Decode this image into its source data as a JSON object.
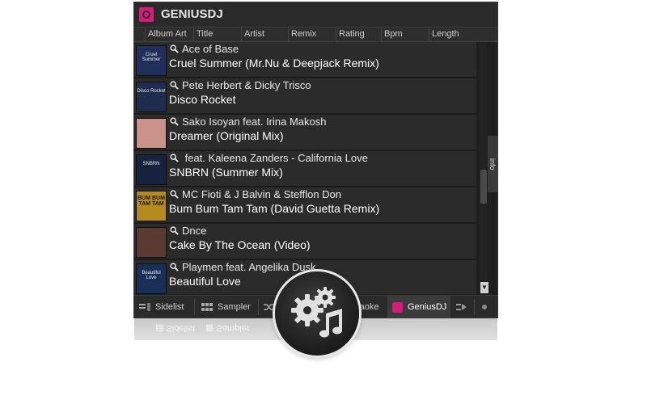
{
  "app": {
    "title": "GENIUSDJ"
  },
  "columns": [
    "Album Art",
    "Title",
    "Artist",
    "Remix",
    "Rating",
    "Bpm",
    "Length"
  ],
  "tracks": [
    {
      "artist": "Ace of Base",
      "title": "Cruel Summer (Mr.Nu & Deepjack Remix)",
      "art_text": "Cruel Summer",
      "art_color": "#20305a"
    },
    {
      "artist": "Pete Herbert & Dicky Trisco",
      "title": "Disco Rocket",
      "art_text": "Disco Rocket",
      "art_color": "#1e2c4e"
    },
    {
      "artist": "Sako Isoyan feat. Irina Makosh",
      "title": "Dreamer (Original Mix)",
      "art_text": "",
      "art_color": "#c9938a"
    },
    {
      "artist": " feat. Kaleena Zanders - California Love",
      "title": "SNBRN (Summer Mix)",
      "art_text": "SNBRN",
      "art_color": "#17233e"
    },
    {
      "artist": "MC Fioti & J Balvin & Stefflon Don",
      "title": "Bum Bum Tam Tam (David Guetta Remix)",
      "art_text": "BUM BUM TAM TAM",
      "art_color": "#b58a1f"
    },
    {
      "artist": "Dnce",
      "title": "Cake By The Ocean (Video)",
      "art_text": "",
      "art_color": "#5a3a30"
    },
    {
      "artist": "Playmen feat. Angelika Dusk",
      "title": "Beautiful Love",
      "art_text": "Beautiful Love",
      "art_color": "#1a2f58"
    }
  ],
  "info_tab": "info",
  "bottom_tabs": [
    {
      "label": "Sidelist",
      "icon": "sidelist-icon"
    },
    {
      "label": "Sampler",
      "icon": "sampler-icon"
    },
    {
      "label": "raoke",
      "icon": "karaoke-icon"
    },
    {
      "label": "GeniusDJ",
      "icon": "geniusdj-icon",
      "active": true
    }
  ],
  "colors": {
    "accent": "#d81b7b",
    "panel": "#1e1e1e",
    "row": "#2b2b2b"
  },
  "overlay_icon": "gears-music-icon"
}
